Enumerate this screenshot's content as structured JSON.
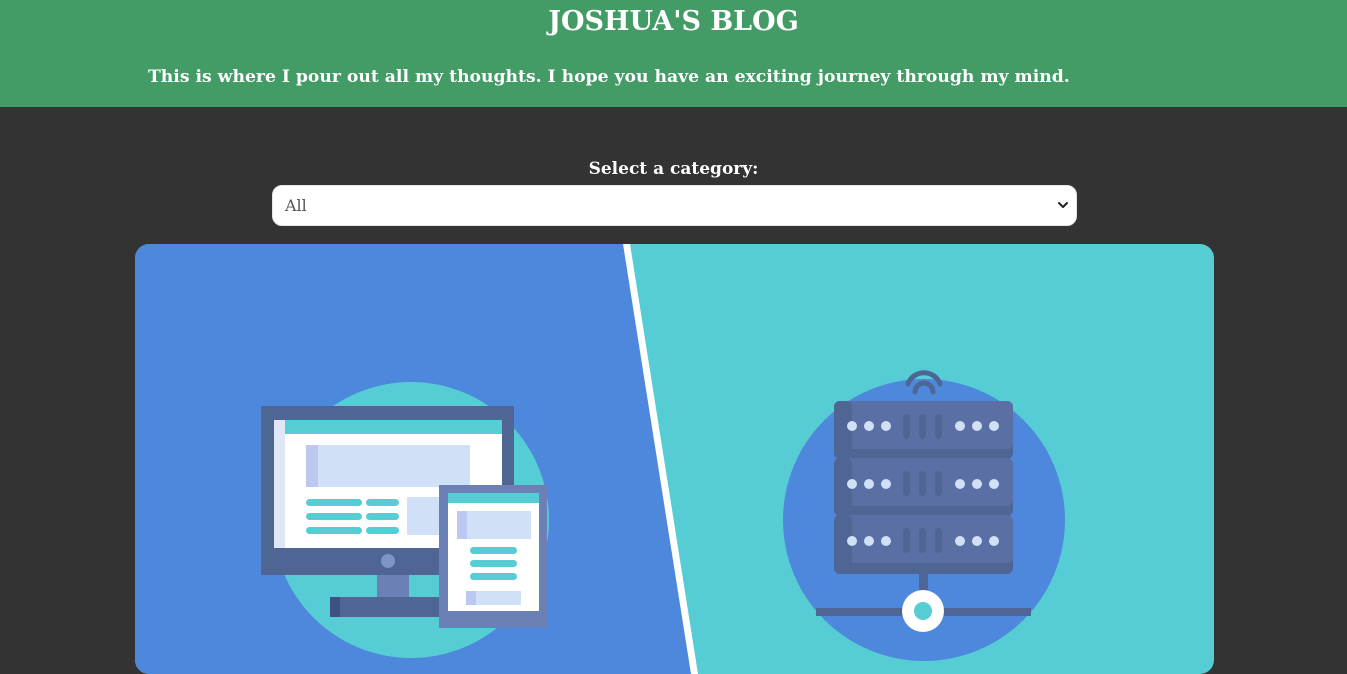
{
  "header": {
    "title": "JOSHUA'S BLOG",
    "tagline": "This is where I pour out all my thoughts. I hope you have an exciting journey through my mind."
  },
  "category_filter": {
    "label": "Select a category:",
    "selected": "All"
  },
  "hero": {
    "left_illustration": "responsive-devices-illustration",
    "right_illustration": "server-stack-illustration"
  },
  "colors": {
    "header_bg": "#439b66",
    "page_bg": "#333333",
    "hero_left_bg": "#4d88dc",
    "hero_right_bg": "#56ccd4"
  }
}
